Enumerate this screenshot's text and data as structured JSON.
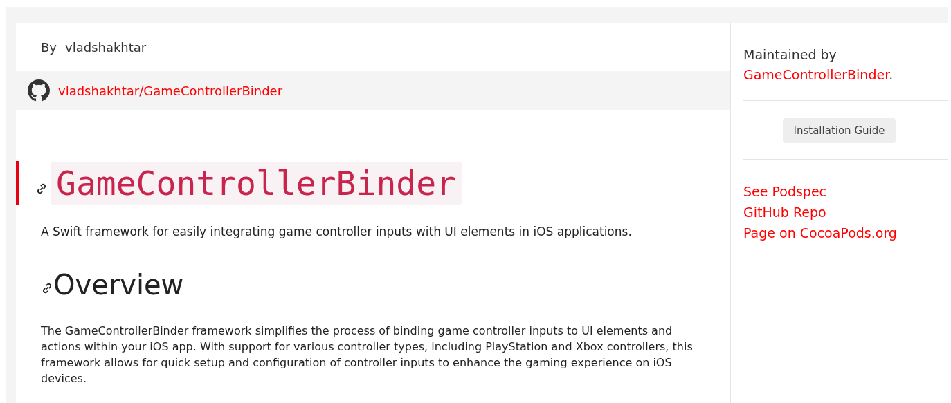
{
  "byline": {
    "prefix": "By",
    "author": "vladshakhtar"
  },
  "repo_link": "vladshakhtar/GameControllerBinder",
  "title": "GameControllerBinder",
  "description": "A Swift framework for easily integrating game controller inputs with UI elements in iOS applications.",
  "sections": [
    {
      "heading": "Overview",
      "text": "The GameControllerBinder framework simplifies the process of binding game controller inputs to UI elements and actions within your iOS app. With support for various controller types, including PlayStation and Xbox controllers, this framework allows for quick setup and configuration of controller inputs to enhance the gaming experience on iOS devices."
    }
  ],
  "sidebar": {
    "maintained_by": "Maintained by",
    "maintainer": "GameControllerBinder",
    "maintainer_suffix": ".",
    "button": "Installation Guide",
    "links": [
      "See Podspec",
      "GitHub Repo",
      "Page on CocoaPods.org"
    ]
  }
}
